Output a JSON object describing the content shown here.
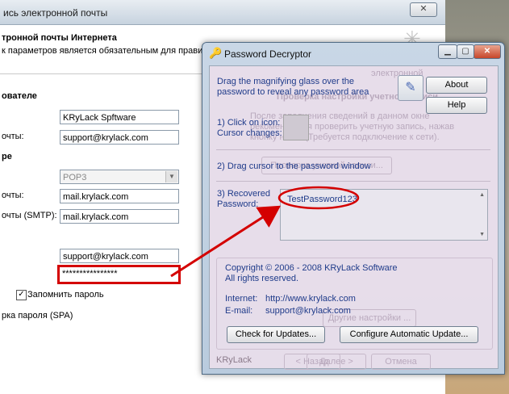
{
  "background_window": {
    "title": "ись электронной почты",
    "close_label": "✕",
    "header_title": "тронной почты Интернета",
    "header_subtitle": "к параметров является обязательным для правил",
    "sections": {
      "user_heading": "ователе",
      "server_heading": "ре"
    },
    "fields": {
      "name_value": "KRyLack Spftware",
      "email_label": "очты:",
      "email_value": "support@krylack.com",
      "account_type_value": "POP3",
      "incoming_label": "очты:",
      "incoming_value": "mail.krylack.com",
      "outgoing_label": "очты (SMTP):",
      "outgoing_value": "mail.krylack.com",
      "username_value": "support@krylack.com",
      "password_value": "****************"
    },
    "remember_password_label": "Запомнить пароль",
    "spa_label": "рка пароля (SPA)",
    "ghost_texts": {
      "check_heading": "Проверка настройки учетной записи",
      "check_desc_1": "После заполнения сведений в данном окне",
      "check_desc_2": "рекомендуется проверить учетную запись, нажав",
      "check_desc_3": "кнопку ниже. (Требуется подключение к сети).",
      "check_button": "Проверка учетной записи...",
      "other_settings": "Другие настройки ...",
      "back_button": "< Назад",
      "next_button": "Далее >",
      "cancel_button": "Отмена",
      "electronic": "электронной"
    }
  },
  "decryptor": {
    "title": "Password Decryptor",
    "instruction": "Drag the magnifying glass over the password to reveal any password area",
    "about_button": "About",
    "help_button": "Help",
    "step1": "1) Click on icon:",
    "step1b": "Cursor changes:",
    "step2": "2) Drag cursor to the password window",
    "step3": "3) Recovered",
    "step3b": "Password:",
    "recovered_password": "TestPassword123",
    "copyright": "Copyright © 2006 - 2008 KRyLack Software",
    "rights": "All rights reserved.",
    "internet_label": "Internet:",
    "internet_value": "http://www.krylack.com",
    "email_label": "E-mail:",
    "email_value": "support@krylack.com",
    "check_updates_button": "Check for Updates...",
    "configure_button": "Configure Automatic Update...",
    "footer": "KRyLack"
  },
  "colors": {
    "highlight_red": "#d40000",
    "link_blue": "#1f3b8a"
  }
}
